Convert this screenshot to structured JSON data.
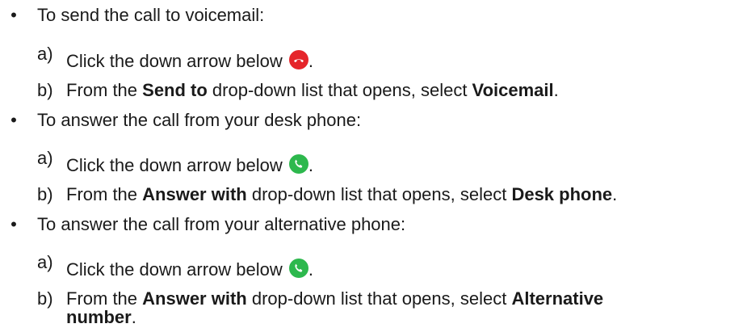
{
  "bullet_glyph": "•",
  "items": [
    {
      "heading": "To send the call to voicemail:",
      "step_a": {
        "letter": "a)",
        "text": "Click the down arrow below",
        "icon": "decline-call-icon",
        "icon_color": "#e5252a",
        "end": "."
      },
      "step_b": {
        "letter": "b)",
        "pre": "From the ",
        "bold1": "Send to",
        "mid": " drop-down list that opens, select ",
        "bold2": "Voicemail",
        "end": "."
      }
    },
    {
      "heading": "To answer the call from your desk phone:",
      "step_a": {
        "letter": "a)",
        "text": "Click the down arrow below",
        "icon": "answer-call-icon",
        "icon_color": "#2db84d",
        "end": "."
      },
      "step_b": {
        "letter": "b)",
        "pre": "From the ",
        "bold1": "Answer with",
        "mid": " drop-down list that opens, select ",
        "bold2": "Desk phone",
        "end": "."
      }
    },
    {
      "heading": "To answer the call from your alternative phone:",
      "step_a": {
        "letter": "a)",
        "text": "Click the down arrow below",
        "icon": "answer-call-icon",
        "icon_color": "#2db84d",
        "end": "."
      },
      "step_b": {
        "letter": "b)",
        "pre": "From the ",
        "bold1": "Answer with",
        "mid": " drop-down list that opens, select ",
        "bold2": "Alternative",
        "cont": "number",
        "end": "."
      }
    }
  ]
}
